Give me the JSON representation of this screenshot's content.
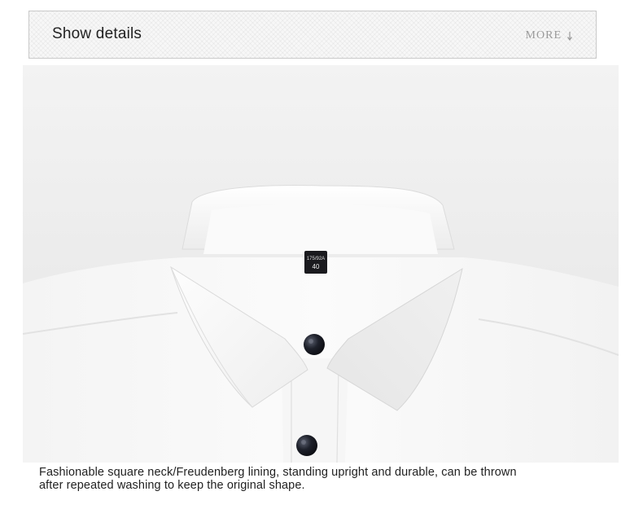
{
  "header": {
    "title": "Show details",
    "more_label": "MORE"
  },
  "product_image": {
    "subject": "white-shirt-collar",
    "tag_line1": "175/92A",
    "tag_line2": "40"
  },
  "caption": {
    "text": "Fashionable square neck/Freudenberg lining, standing upright and durable, can be thrown after repeated washing to keep the original shape."
  },
  "icons": {
    "more_arrow": "arrow-down-icon"
  },
  "colors": {
    "border": "#c9c9c9",
    "more_text": "#9a9a9a",
    "button": "#1a1d26"
  }
}
